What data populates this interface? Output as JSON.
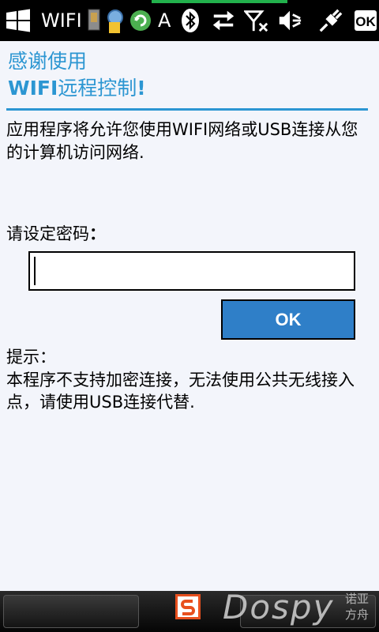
{
  "statusbar": {
    "title": "WIFI",
    "title_tail": "A",
    "icons": [
      "windows-start-icon",
      "app-tray-icon",
      "bluetooth-icon",
      "sync-arrows-icon",
      "no-signal-icon",
      "volume-muted-icon",
      "power-plug-icon",
      "ok-icon"
    ],
    "ok_label": "OK",
    "signal_color": "#22b14c"
  },
  "header": {
    "line1": "感谢使用",
    "line2_bold": "WIFI",
    "line2_rest": "远程控制",
    "line2_bang": "!",
    "accent": "#2c96d2"
  },
  "description": "应用程序将允许您使用WIFI网络或USB连接从您的计算机访问网络.",
  "password": {
    "label": "请设定密码",
    "colon": "：",
    "value": "",
    "placeholder": ""
  },
  "ok_button": {
    "label": "OK",
    "color": "#2f7fc8"
  },
  "hint": {
    "title": "提示：",
    "body": "本程序不支持加密连接，无法使用公共无线接入点，请使用USB连接代替."
  },
  "bottombar": {
    "watermark": "Dospy",
    "watermark_cn": "诺亚方舟",
    "ime_icon": "sogou-ime-icon"
  }
}
